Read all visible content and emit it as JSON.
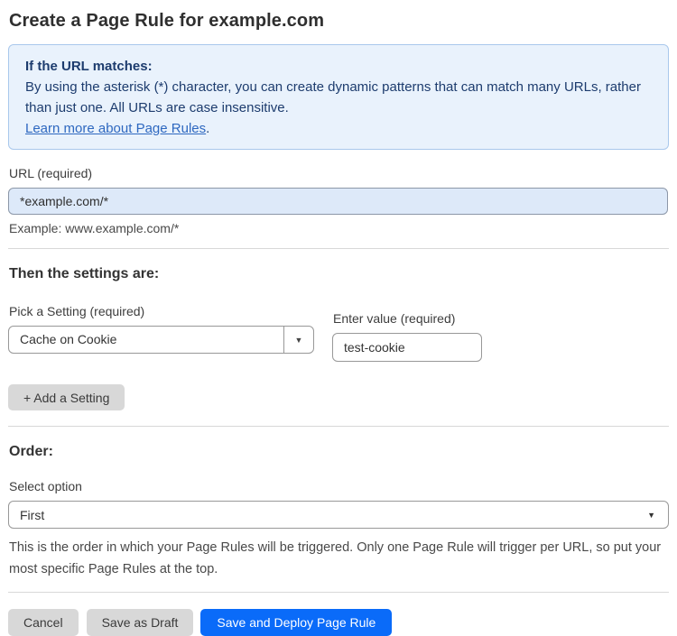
{
  "page": {
    "title": "Create a Page Rule for example.com"
  },
  "info_box": {
    "heading": "If the URL matches:",
    "body": "By using the asterisk (*) character, you can create dynamic patterns that can match many URLs, rather than just one. All URLs are case insensitive.",
    "link_label": "Learn more about Page Rules",
    "link_suffix": "."
  },
  "url_field": {
    "label": "URL (required)",
    "value": "*example.com/*",
    "example": "Example: www.example.com/*"
  },
  "settings_section": {
    "heading": "Then the settings are:",
    "setting_label": "Pick a Setting (required)",
    "setting_value": "Cache on Cookie",
    "value_label": "Enter value (required)",
    "value_value": "test-cookie",
    "add_setting_label": "+ Add a Setting",
    "dropdown_arrow": "▼"
  },
  "order_section": {
    "heading": "Order:",
    "select_label": "Select option",
    "select_value": "First",
    "dropdown_arrow": "▼",
    "help_text": "This is the order in which your Page Rules will be triggered. Only one Page Rule will trigger per URL, so put your most specific Page Rules at the top."
  },
  "footer": {
    "cancel_label": "Cancel",
    "save_draft_label": "Save as Draft",
    "save_deploy_label": "Save and Deploy Page Rule"
  },
  "colors": {
    "info_background": "#e9f2fc",
    "info_border": "#a9c8ec",
    "info_text": "#1d3c6e",
    "link_blue": "#2e68c0",
    "url_input_background": "#dde9f9",
    "primary_button_blue": "#0a6bf9",
    "gray_button": "#d8d8d8"
  }
}
